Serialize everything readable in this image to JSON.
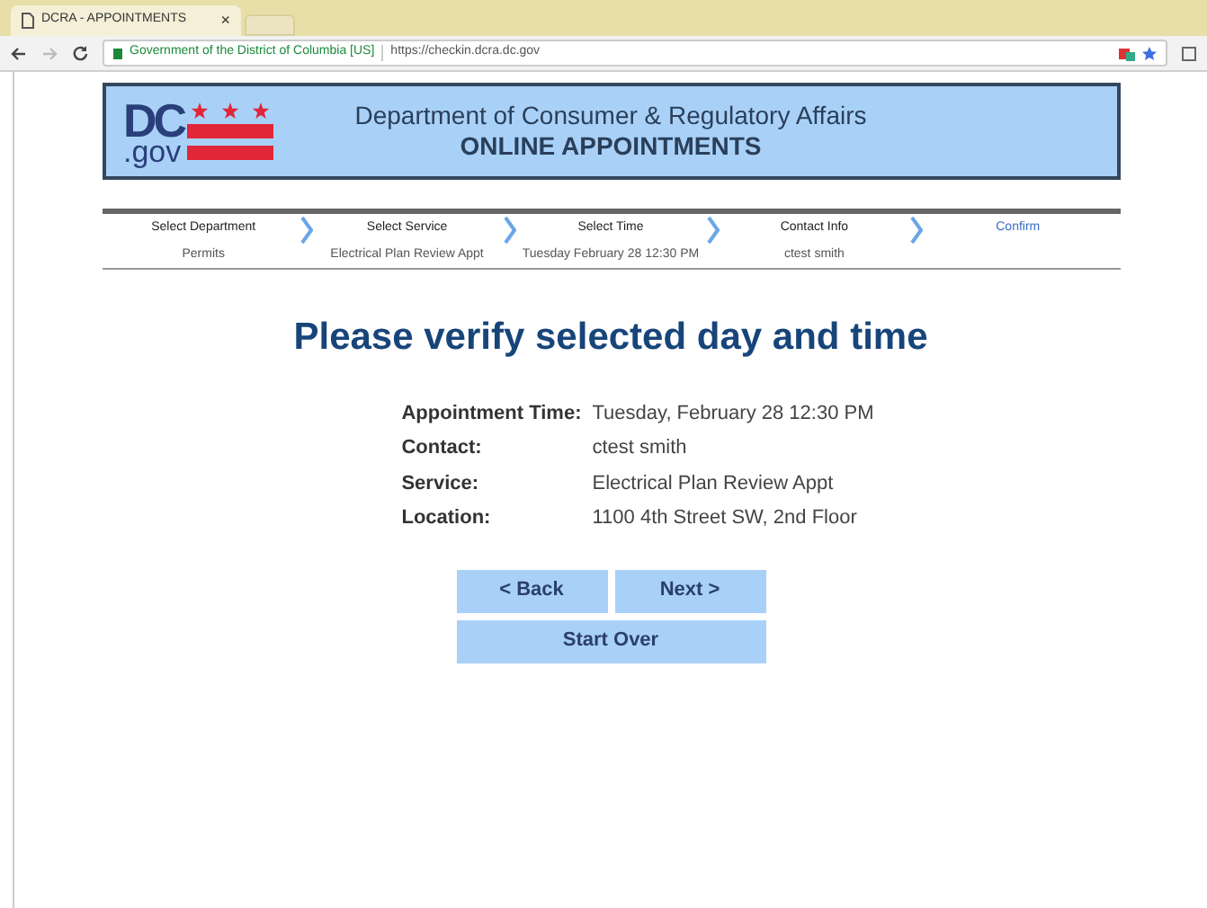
{
  "browser": {
    "tab_title": "DCRA - APPOINTMENTS",
    "tab_close": "×",
    "site_identity": "Government of the District of Columbia [US]",
    "url": "https://checkin.dcra.dc.gov"
  },
  "header": {
    "logo_dc": "DC",
    "logo_gov": ".gov",
    "department": "Department of Consumer & Regulatory Affairs",
    "subtitle": "ONLINE APPOINTMENTS"
  },
  "steps": [
    {
      "label": "Select Department",
      "value": "Permits",
      "selected": false
    },
    {
      "label": "Select Service",
      "value": "Electrical Plan Review Appt",
      "selected": false
    },
    {
      "label": "Select Time",
      "value": "Tuesday February 28 12:30 PM",
      "selected": false
    },
    {
      "label": "Contact Info",
      "value": "ctest smith",
      "selected": false
    },
    {
      "label": "Confirm",
      "selected": true
    }
  ],
  "heading": "Please verify selected day and time",
  "details": [
    {
      "label": "Appointment Time:",
      "value": "Tuesday, February 28 12:30 PM"
    },
    {
      "label": "Contact:",
      "value": "ctest smith"
    },
    {
      "label": "Service:",
      "value": "Electrical Plan Review Appt"
    },
    {
      "label": "Location:",
      "value": "1100 4th Street SW, 2nd Floor"
    }
  ],
  "buttons": {
    "back": "< Back",
    "next": "Next >",
    "start_over": "Start Over"
  }
}
